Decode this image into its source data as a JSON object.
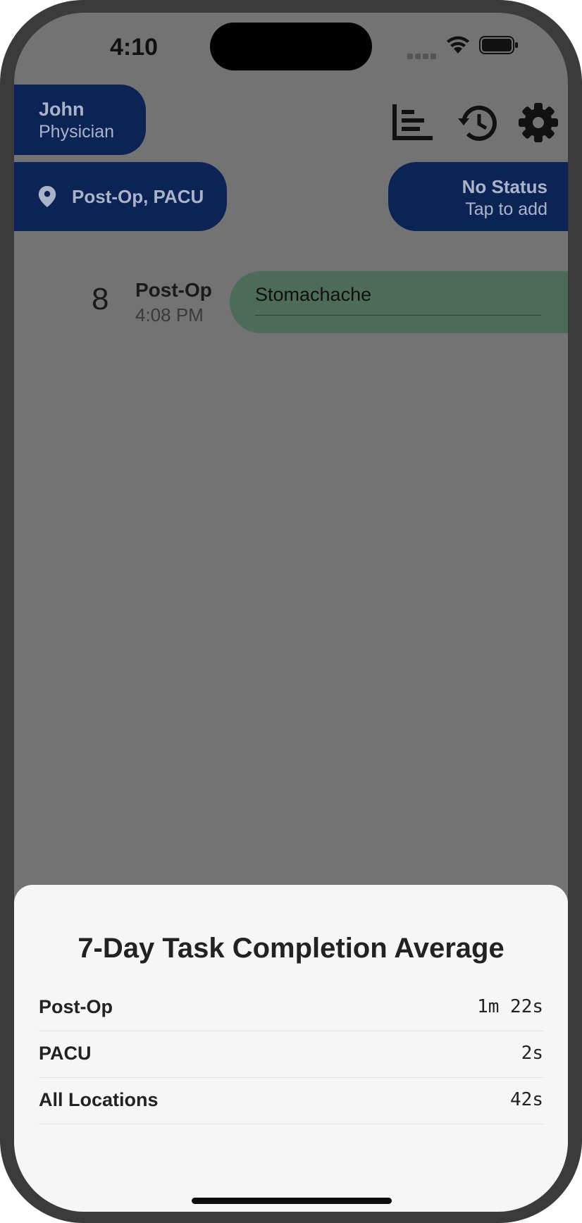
{
  "status_bar": {
    "time": "4:10"
  },
  "user": {
    "name": "John",
    "role": "Physician"
  },
  "location": {
    "label": "Post-Op, PACU",
    "icon": "location-pin-icon"
  },
  "status": {
    "title": "No Status",
    "subtitle": "Tap to add"
  },
  "toolbar": {
    "icons": [
      "bar-chart-icon",
      "history-icon",
      "settings-icon"
    ]
  },
  "task": {
    "number": "8",
    "location": "Post-Op",
    "time": "4:08 PM",
    "label": "Stomachache",
    "color": "#4c6b58"
  },
  "sheet": {
    "title": "7-Day Task Completion Average",
    "rows": [
      {
        "label": "Post-Op",
        "value": "1m 22s"
      },
      {
        "label": "PACU",
        "value": "2s"
      },
      {
        "label": "All Locations",
        "value": "42s"
      }
    ]
  },
  "colors": {
    "accent": "#0c2356",
    "overlay": "#737373",
    "sheet_bg": "#f6f6f6"
  }
}
